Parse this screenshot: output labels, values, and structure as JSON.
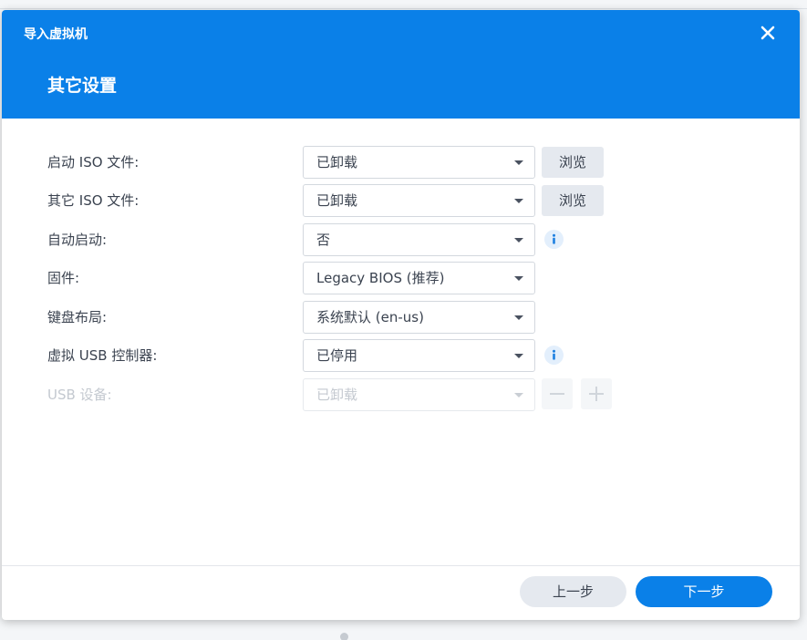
{
  "dialog": {
    "title": "导入虚拟机",
    "step_title": "其它设置",
    "close_icon": "close-icon"
  },
  "form": {
    "boot_iso": {
      "label": "启动 ISO 文件:",
      "value": "已卸载",
      "browse_label": "浏览"
    },
    "other_iso": {
      "label": "其它 ISO 文件:",
      "value": "已卸载",
      "browse_label": "浏览"
    },
    "autostart": {
      "label": "自动启动:",
      "value": "否",
      "icon": "info-icon"
    },
    "firmware": {
      "label": "固件:",
      "value": "Legacy BIOS (推荐)"
    },
    "keyboard": {
      "label": "键盘布局:",
      "value": "系统默认 (en-us)"
    },
    "usb_controller": {
      "label": "虚拟 USB 控制器:",
      "value": "已停用",
      "icon": "info-icon"
    },
    "usb_device": {
      "label": "USB 设备:",
      "value": "已卸载",
      "disabled": true,
      "remove_icon": "minus-icon",
      "add_icon": "plus-icon"
    }
  },
  "footer": {
    "prev_label": "上一步",
    "next_label": "下一步"
  },
  "colors": {
    "accent": "#0a80e8",
    "info_icon": "#1d7fe0",
    "button_gray": "#e5e9ef"
  }
}
